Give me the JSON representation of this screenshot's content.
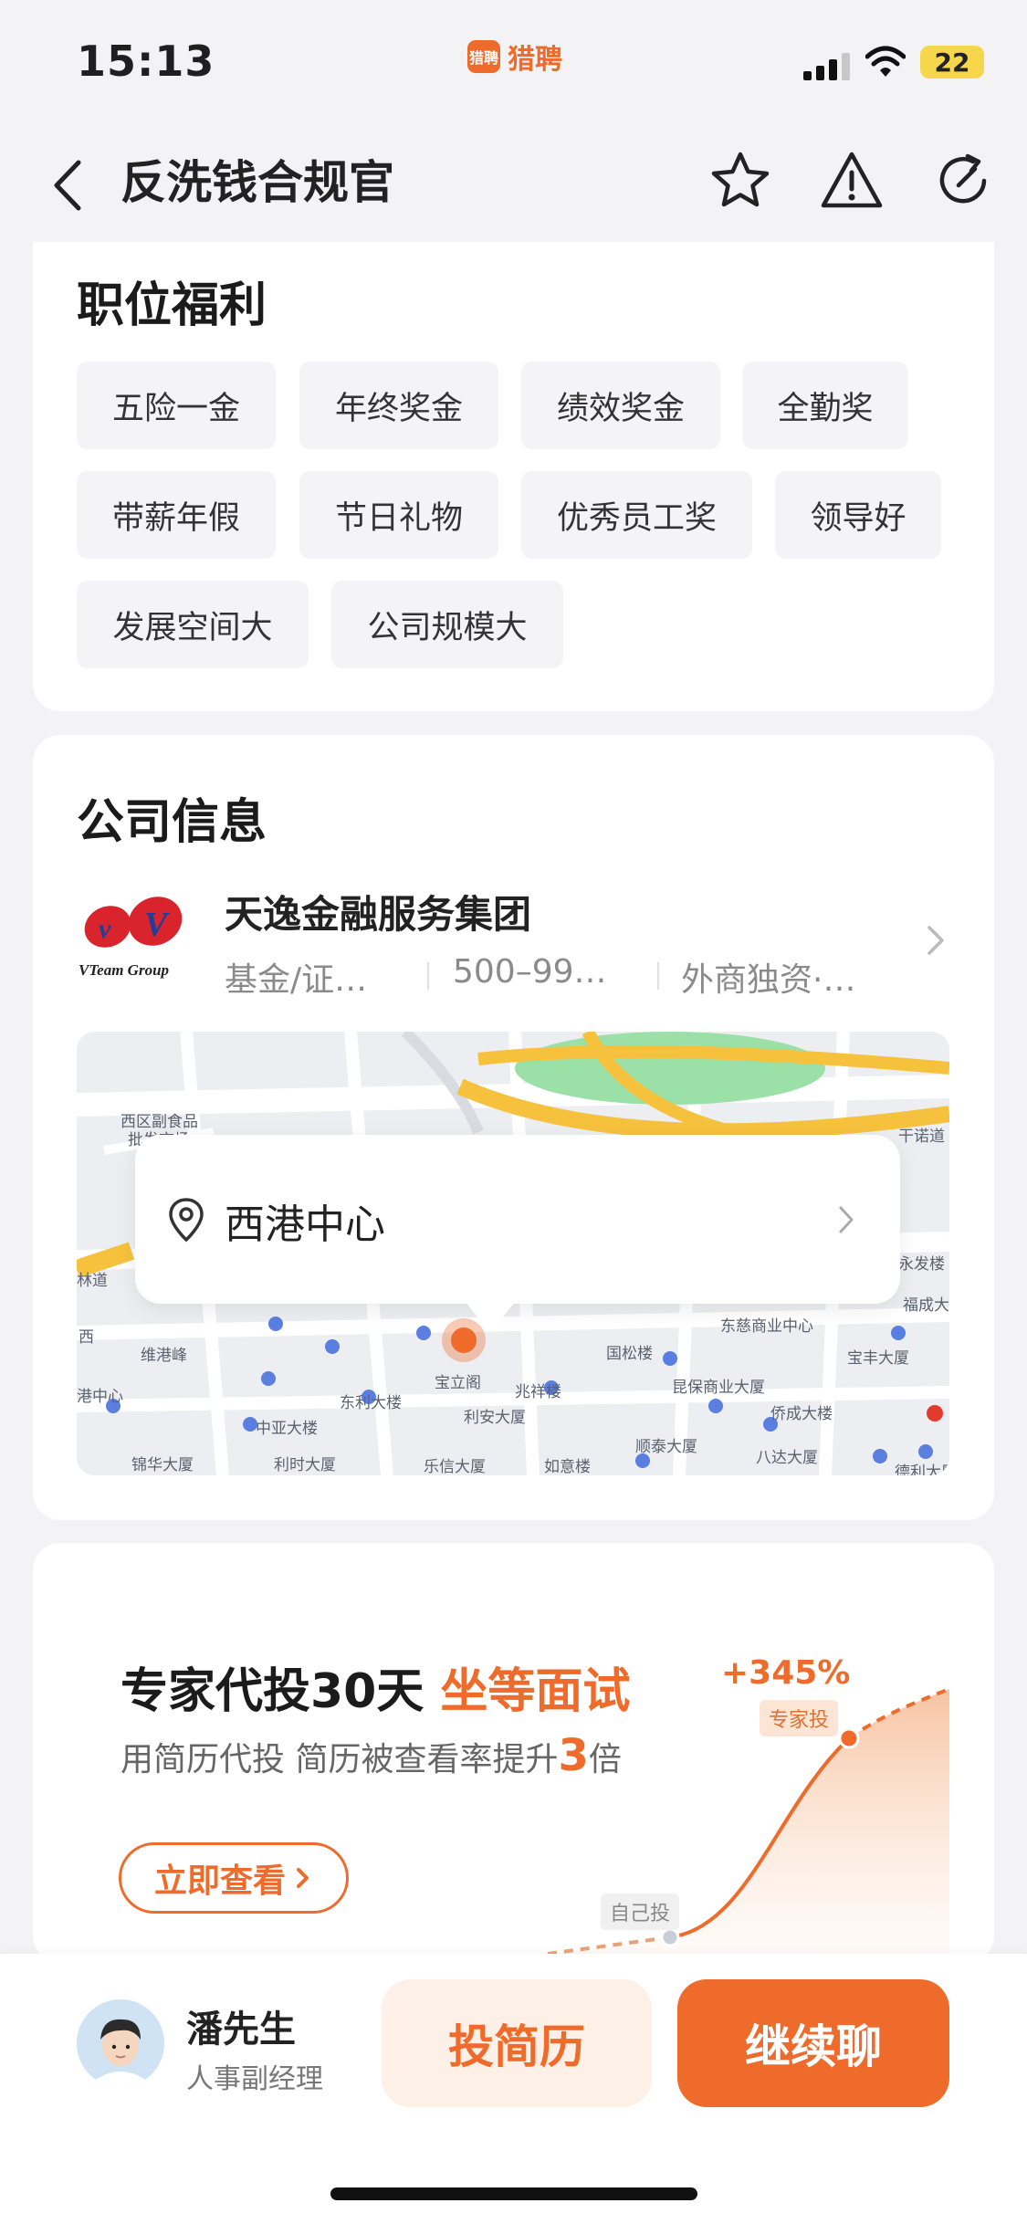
{
  "status_bar": {
    "time": "15:13",
    "app_name": "猎聘",
    "app_logo_text": "猎聘",
    "battery": "22"
  },
  "nav": {
    "title": "反洗钱合规官",
    "icons": [
      "back-chevron-icon",
      "star-icon",
      "warning-icon",
      "refresh-icon"
    ]
  },
  "benefits": {
    "title": "职位福利",
    "tags": [
      "五险一金",
      "年终奖金",
      "绩效奖金",
      "全勤奖",
      "带薪年假",
      "节日礼物",
      "优秀员工奖",
      "领导好",
      "发展空间大",
      "公司规模大"
    ]
  },
  "company": {
    "section_title": "公司信息",
    "logo_text": "VTeam Group",
    "name": "天逸金融服务集团",
    "industry": "基金/证…",
    "size": "500–99…",
    "type": "外商独资·…",
    "location": "西港中心",
    "map_labels": [
      "西区副食品",
      "批发市场",
      "干诺道",
      "永发楼",
      "福成大",
      "东慈商业中心",
      "宝丰大厦",
      "国松楼",
      "维港峰",
      "东利大楼",
      "宝立阁",
      "兆祥楼",
      "昆保商业大厦",
      "侨成大楼",
      "中亚大楼",
      "利安大厦",
      "顺泰大厦",
      "八达大厦",
      "锦华大厦",
      "利时大厦",
      "乐信大厦",
      "如意楼",
      "德利大厦",
      "林道",
      "港中心",
      "西"
    ]
  },
  "promo": {
    "title_main": "专家代投30天",
    "title_highlight": "坐等面试",
    "subtitle_pre": "用简历代投 简历被查看率提升",
    "subtitle_num": "3",
    "subtitle_post": "倍",
    "button": "立即查看",
    "chart_pct": "+345%",
    "label_expert": "专家投",
    "label_self": "自己投",
    "accent_color": "#ee6b2c"
  },
  "bottom_bar": {
    "hr_name": "潘先生",
    "hr_role": "人事副经理",
    "resume_button": "投简历",
    "chat_button": "继续聊"
  }
}
